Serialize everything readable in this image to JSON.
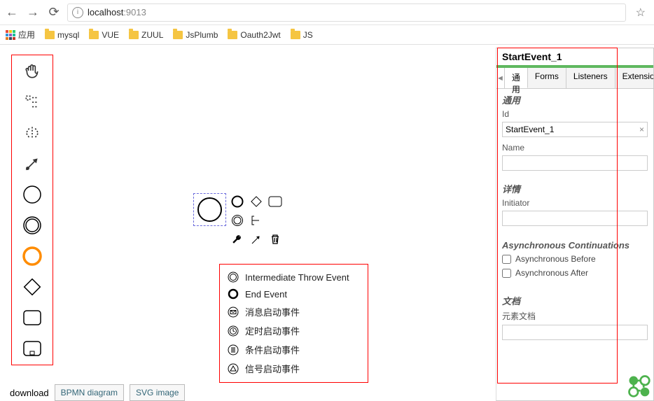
{
  "nav": {
    "url_prefix": "localhost",
    "url_port": ":9013"
  },
  "bookmarks": {
    "apps_label": "应用",
    "items": [
      "mysql",
      "VUE",
      "ZUUL",
      "JsPlumb",
      "Oauth2Jwt",
      "JS"
    ]
  },
  "palette_tools": [
    "hand",
    "lasso",
    "space",
    "connect",
    "start-event",
    "end-event",
    "intermediate-event",
    "gateway",
    "task",
    "collapsed-subprocess"
  ],
  "popup": {
    "items": [
      {
        "label": "Intermediate Throw Event",
        "icon": "double-circle"
      },
      {
        "label": "End Event",
        "icon": "thick-circle"
      },
      {
        "label": "消息启动事件",
        "icon": "message"
      },
      {
        "label": "定时启动事件",
        "icon": "timer"
      },
      {
        "label": "条件启动事件",
        "icon": "conditional"
      },
      {
        "label": "信号启动事件",
        "icon": "signal"
      }
    ]
  },
  "download": {
    "label": "download",
    "bpmn_btn": "BPMN diagram",
    "svg_btn": "SVG image"
  },
  "panel": {
    "title": "StartEvent_1",
    "tabs": [
      "通用",
      "Forms",
      "Listeners",
      "Extensions"
    ],
    "general_heading": "通用",
    "id_label": "Id",
    "id_value": "StartEvent_1",
    "name_label": "Name",
    "name_value": "",
    "details_heading": "详情",
    "initiator_label": "Initiator",
    "initiator_value": "",
    "async_heading": "Asynchronous Continuations",
    "async_before": "Asynchronous Before",
    "async_after": "Asynchronous After",
    "docs_heading": "文档",
    "docs_label": "元素文档"
  }
}
